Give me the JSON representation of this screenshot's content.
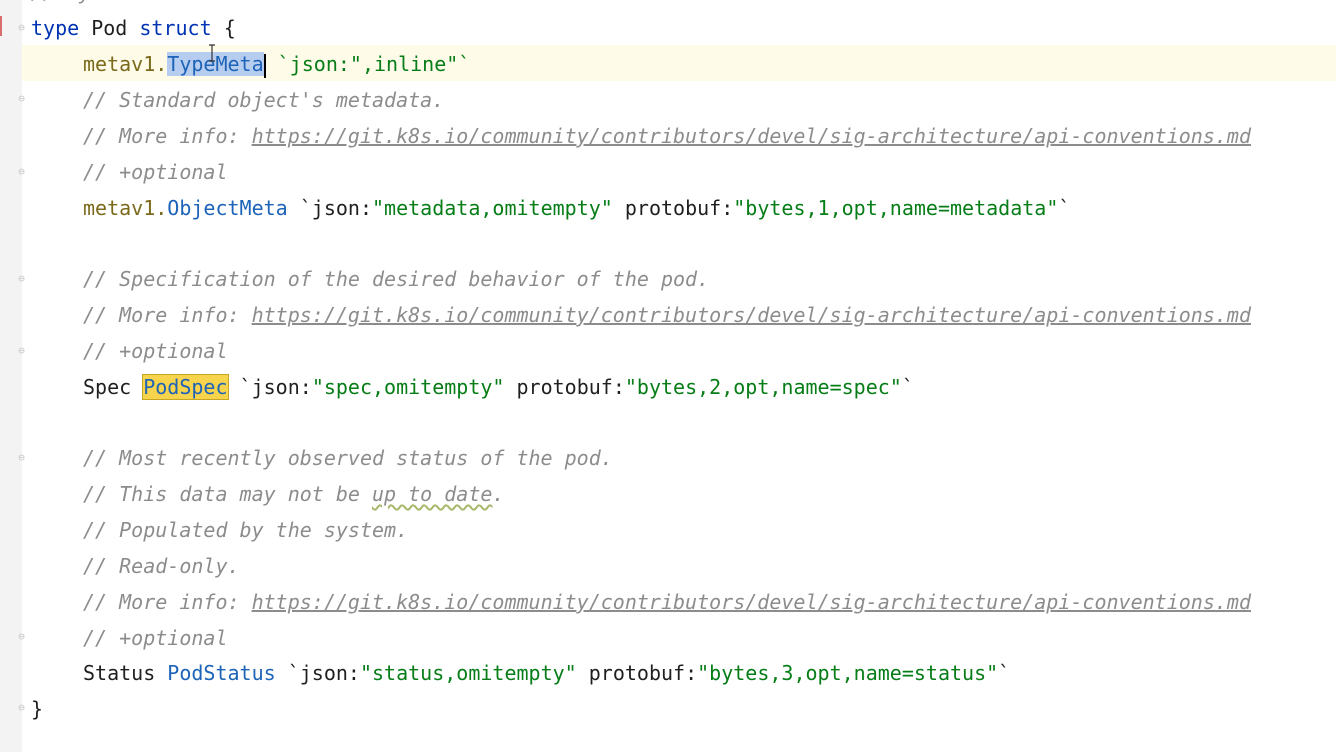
{
  "editor": {
    "truncated_top_comment": "// by clients and scheduled onto hosts.",
    "lines": {
      "l1": {
        "kw_type": "type",
        "name": "Pod",
        "kw_struct": "struct",
        "brace": "{"
      },
      "l2": {
        "pkg": "metav1.",
        "type": "TypeMeta",
        "tag": "`json:\",inline\"`"
      },
      "l3": {
        "comment": "// Standard object's metadata."
      },
      "l4": {
        "comment": "// More info: ",
        "link": "https://git.k8s.io/community/contributors/devel/sig-architecture/api-conventions.md"
      },
      "l5": {
        "comment": "// +optional"
      },
      "l6": {
        "pkg": "metav1.",
        "type": "ObjectMeta",
        "tag_a": " `json:",
        "tag_b": "\"metadata,omitempty\"",
        "tag_c": " protobuf:",
        "tag_d": "\"bytes,1,opt,name=metadata\"",
        "tag_e": "`"
      },
      "l8": {
        "comment": "// Specification of the desired behavior of the pod."
      },
      "l9": {
        "comment": "// More info: ",
        "link": "https://git.k8s.io/community/contributors/devel/sig-architecture/api-conventions.md"
      },
      "l10": {
        "comment": "// +optional"
      },
      "l11": {
        "field": "Spec ",
        "type": "PodSpec",
        "tag_a": " `json:",
        "tag_b": "\"spec,omitempty\"",
        "tag_c": " protobuf:",
        "tag_d": "\"bytes,2,opt,name=spec\"",
        "tag_e": "`"
      },
      "l13": {
        "comment": "// Most recently observed status of the pod."
      },
      "l14": {
        "comment_a": "// This data may not be ",
        "comment_b": "up to date",
        "comment_c": "."
      },
      "l15": {
        "comment": "// Populated by the system."
      },
      "l16": {
        "comment": "// Read-only."
      },
      "l17": {
        "comment": "// More info: ",
        "link": "https://git.k8s.io/community/contributors/devel/sig-architecture/api-conventions.md"
      },
      "l18": {
        "comment": "// +optional"
      },
      "l19": {
        "field": "Status ",
        "type": "PodStatus",
        "tag_a": " `json:",
        "tag_b": "\"status,omitempty\"",
        "tag_c": " protobuf:",
        "tag_d": "\"bytes,3,opt,name=status\"",
        "tag_e": "`"
      },
      "l20": {
        "brace": "}"
      }
    },
    "colors": {
      "keyword": "#0033b3",
      "type": "#1d63b8",
      "string": "#067d17",
      "comment": "#8c8c8c",
      "selection": "#b6cdef",
      "highlight": "#f7d44c"
    }
  }
}
